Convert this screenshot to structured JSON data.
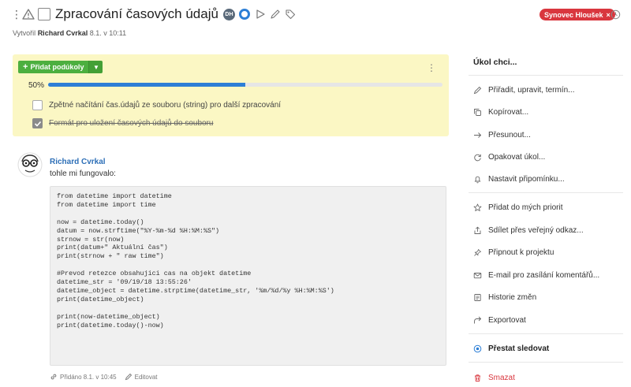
{
  "task": {
    "title": "Zpracování časových údajů",
    "badge_initials": "DH",
    "created_prefix": "Vytvořil",
    "created_author": "Richard Cvrkal",
    "created_date": "8.1. v 10:11",
    "assignee": "Synovec Hloušek",
    "assignee_remove": "×"
  },
  "subtasks": {
    "add_label": "Přidat podúkoly",
    "progress_text": "50%",
    "progress_value": 0.5,
    "items": [
      {
        "text": "Zpětné načítání čas.údajů ze souboru (string) pro další zpracování",
        "done": false
      },
      {
        "text": "Formát pro uložení časových údajů do souboru",
        "done": true
      }
    ]
  },
  "comment": {
    "author": "Richard Cvrkal",
    "text": "tohle mi fungovalo:",
    "code": "from datetime import datetime\nfrom datetime import time\n\nnow = datetime.today()\ndatum = now.strftime(\"%Y-%m-%d %H:%M:%S\")\nstrnow = str(now)\nprint(datum+\" Aktuální čas\")\nprint(strnow + \" raw time\")\n\n#Prevod retezce obsahujici cas na objekt datetime\ndatetime_str = '09/19/18 13:55:26'\ndatetime_object = datetime.strptime(datetime_str, '%m/%d/%y %H:%M:%S')\nprint(datetime_object)\n\nprint(now-datetime_object)\nprint(datetime.today()-now)",
    "added": "Přidáno 8.1. v 10:45",
    "edit": "Editovat"
  },
  "menu": {
    "title": "Úkol chci...",
    "items": [
      {
        "label": "Přiřadit, upravit, termín...",
        "icon": "pencil-icon"
      },
      {
        "label": "Kopírovat...",
        "icon": "copy-icon"
      },
      {
        "label": "Přesunout...",
        "icon": "arrow-right-icon"
      },
      {
        "label": "Opakovat úkol...",
        "icon": "repeat-icon"
      },
      {
        "label": "Nastavit připomínku...",
        "icon": "bell-icon"
      },
      {
        "label": "Přidat do mých priorit",
        "icon": "star-icon"
      },
      {
        "label": "Sdílet přes veřejný odkaz...",
        "icon": "share-icon"
      },
      {
        "label": "Připnout k projektu",
        "icon": "pin-icon"
      },
      {
        "label": "E-mail pro zasílání komentářů...",
        "icon": "mail-icon"
      },
      {
        "label": "Historie změn",
        "icon": "history-icon"
      },
      {
        "label": "Exportovat",
        "icon": "export-icon"
      },
      {
        "label": "Přestat sledovat",
        "icon": "eye-icon"
      },
      {
        "label": "Smazat",
        "icon": "trash-icon"
      }
    ]
  },
  "colors": {
    "accent": "#2d7fd6",
    "add_button": "#4caf3f",
    "assignee_badge": "#d9363e",
    "subtask_panel": "#fbf7c4",
    "danger": "#d9363e"
  }
}
